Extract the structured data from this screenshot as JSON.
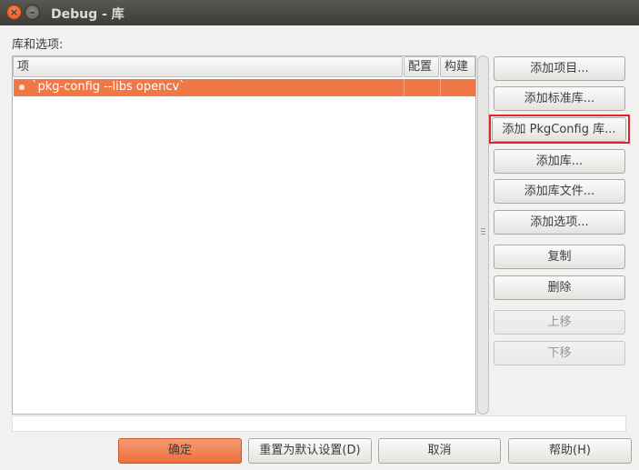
{
  "window": {
    "title": "Debug - 库",
    "close_glyph": "×",
    "minimize_glyph": "–"
  },
  "section_label": "库和选项:",
  "table": {
    "columns": [
      "项",
      "配置",
      "构建"
    ],
    "rows": [
      {
        "item": "`pkg-config --libs opencv`",
        "config": "",
        "build": "",
        "selected": true
      }
    ]
  },
  "side_buttons": {
    "add_item": "添加项目...",
    "add_standard_lib": "添加标准库...",
    "add_pkgconfig_lib": "添加 PkgConfig 库...",
    "add_lib": "添加库...",
    "add_lib_file": "添加库文件...",
    "add_option": "添加选项...",
    "copy": "复制",
    "delete": "删除",
    "move_up": "上移",
    "move_down": "下移"
  },
  "bottom_buttons": {
    "ok": "确定",
    "reset_default": "重置为默认设置(D)",
    "cancel": "取消",
    "help": "帮助(H)"
  },
  "colors": {
    "selection": "#f07746",
    "highlight_box": "#e0232d",
    "titlebar": "#3c3b37"
  }
}
